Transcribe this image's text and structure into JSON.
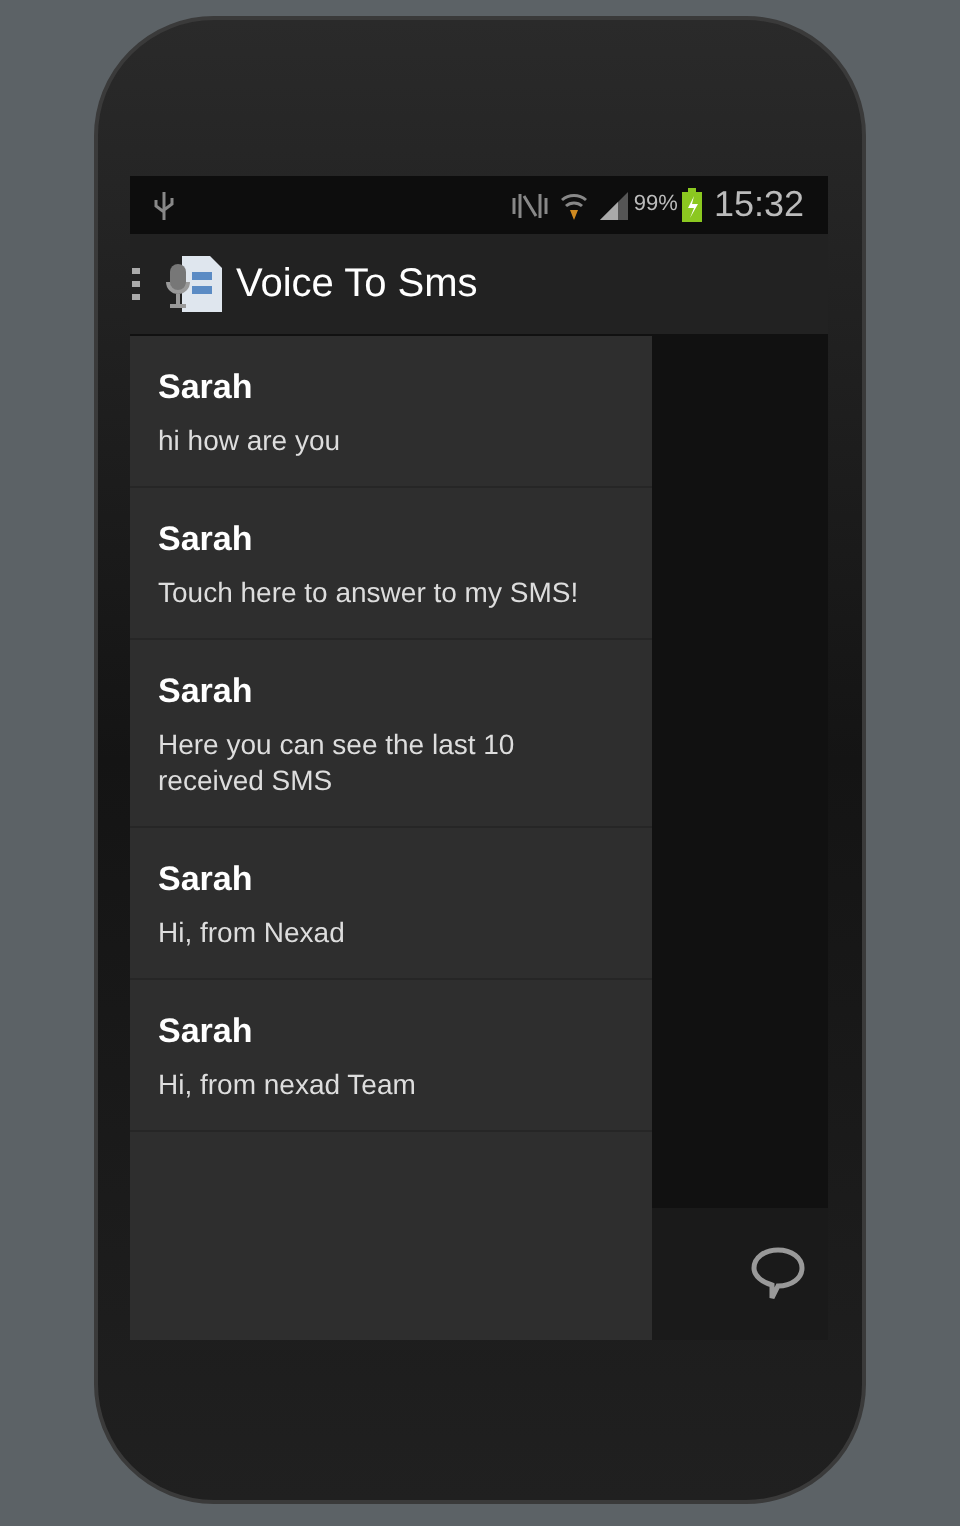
{
  "status_bar": {
    "battery": "99%",
    "time": "15:32"
  },
  "action_bar": {
    "title": "Voice To Sms"
  },
  "messages": [
    {
      "sender": "Sarah",
      "text": "hi how are you"
    },
    {
      "sender": "Sarah",
      "text": "Touch here to answer to my SMS!"
    },
    {
      "sender": "Sarah",
      "text": "Here you can see the last 10 received SMS"
    },
    {
      "sender": "Sarah",
      "text": "Hi, from Nexad"
    },
    {
      "sender": "Sarah",
      "text": "Hi, from nexad Team"
    }
  ]
}
